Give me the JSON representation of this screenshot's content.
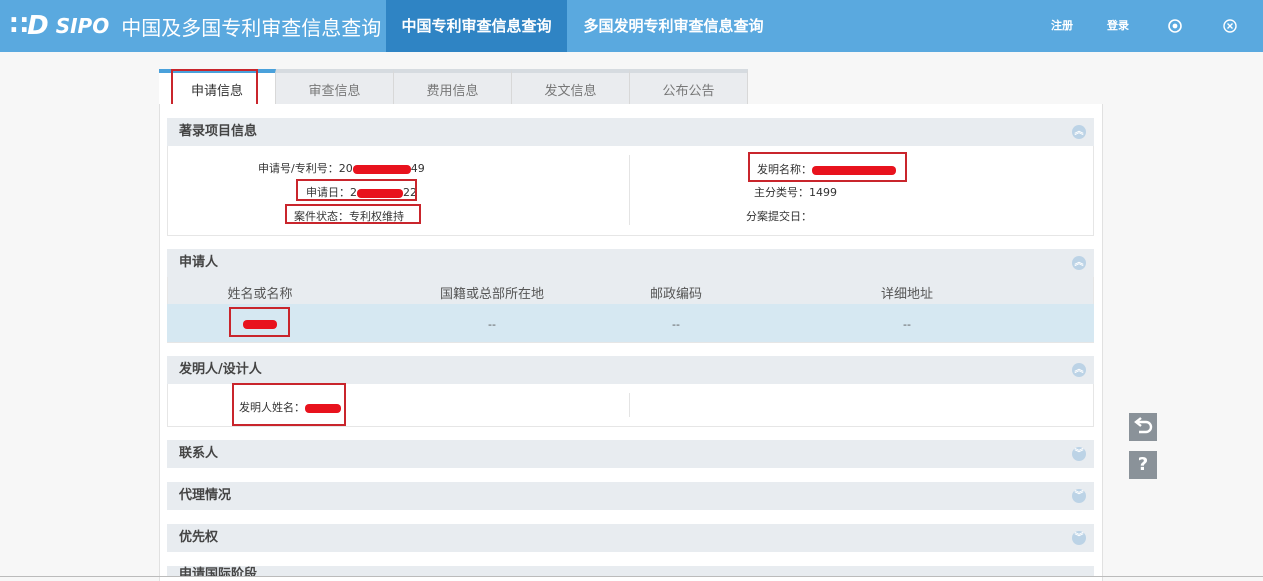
{
  "header": {
    "logo_mark": "∷D",
    "logo_sipo": "SIPO",
    "logo_title": "中国及多国专利审查信息查询",
    "nav": [
      {
        "label": "中国专利审查信息查询"
      },
      {
        "label": "多国发明专利审查信息查询"
      }
    ],
    "register": "注册",
    "login": "登录",
    "icons": [
      "globe-icon",
      "close-icon"
    ]
  },
  "tabs": [
    {
      "label": "申请信息"
    },
    {
      "label": "审查信息"
    },
    {
      "label": "费用信息"
    },
    {
      "label": "发文信息"
    },
    {
      "label": "公布公告"
    }
  ],
  "biblio": {
    "title": "著录项目信息",
    "app_no_label": "申请号/专利号：",
    "app_no_prefix": "20",
    "app_no_suffix": "49",
    "app_date_label": "申请日：",
    "app_date_prefix": "2",
    "app_date_suffix": "22",
    "status_label": "案件状态：",
    "status_value": "专利权维持",
    "invention_name_label": "发明名称：",
    "main_class_label": "主分类号：",
    "main_class_value": "1499",
    "div_date_label": "分案提交日："
  },
  "applicant": {
    "title": "申请人",
    "columns": [
      "姓名或名称",
      "国籍或总部所在地",
      "邮政编码",
      "详细地址"
    ],
    "row": {
      "nationality": "--",
      "postcode": "--",
      "address": "--"
    }
  },
  "inventor": {
    "title": "发明人/设计人",
    "name_label": "发明人姓名："
  },
  "sections": [
    {
      "title": "联系人"
    },
    {
      "title": "代理情况"
    },
    {
      "title": "优先权"
    },
    {
      "title": "申请国际阶段"
    }
  ],
  "side": {
    "back_glyph": "⮌",
    "help_glyph": "?"
  },
  "colors": {
    "header_bg": "#5aa9df",
    "active_nav": "#2f84c4",
    "highlight_box": "#c9252c",
    "redaction": "#e8121d"
  }
}
